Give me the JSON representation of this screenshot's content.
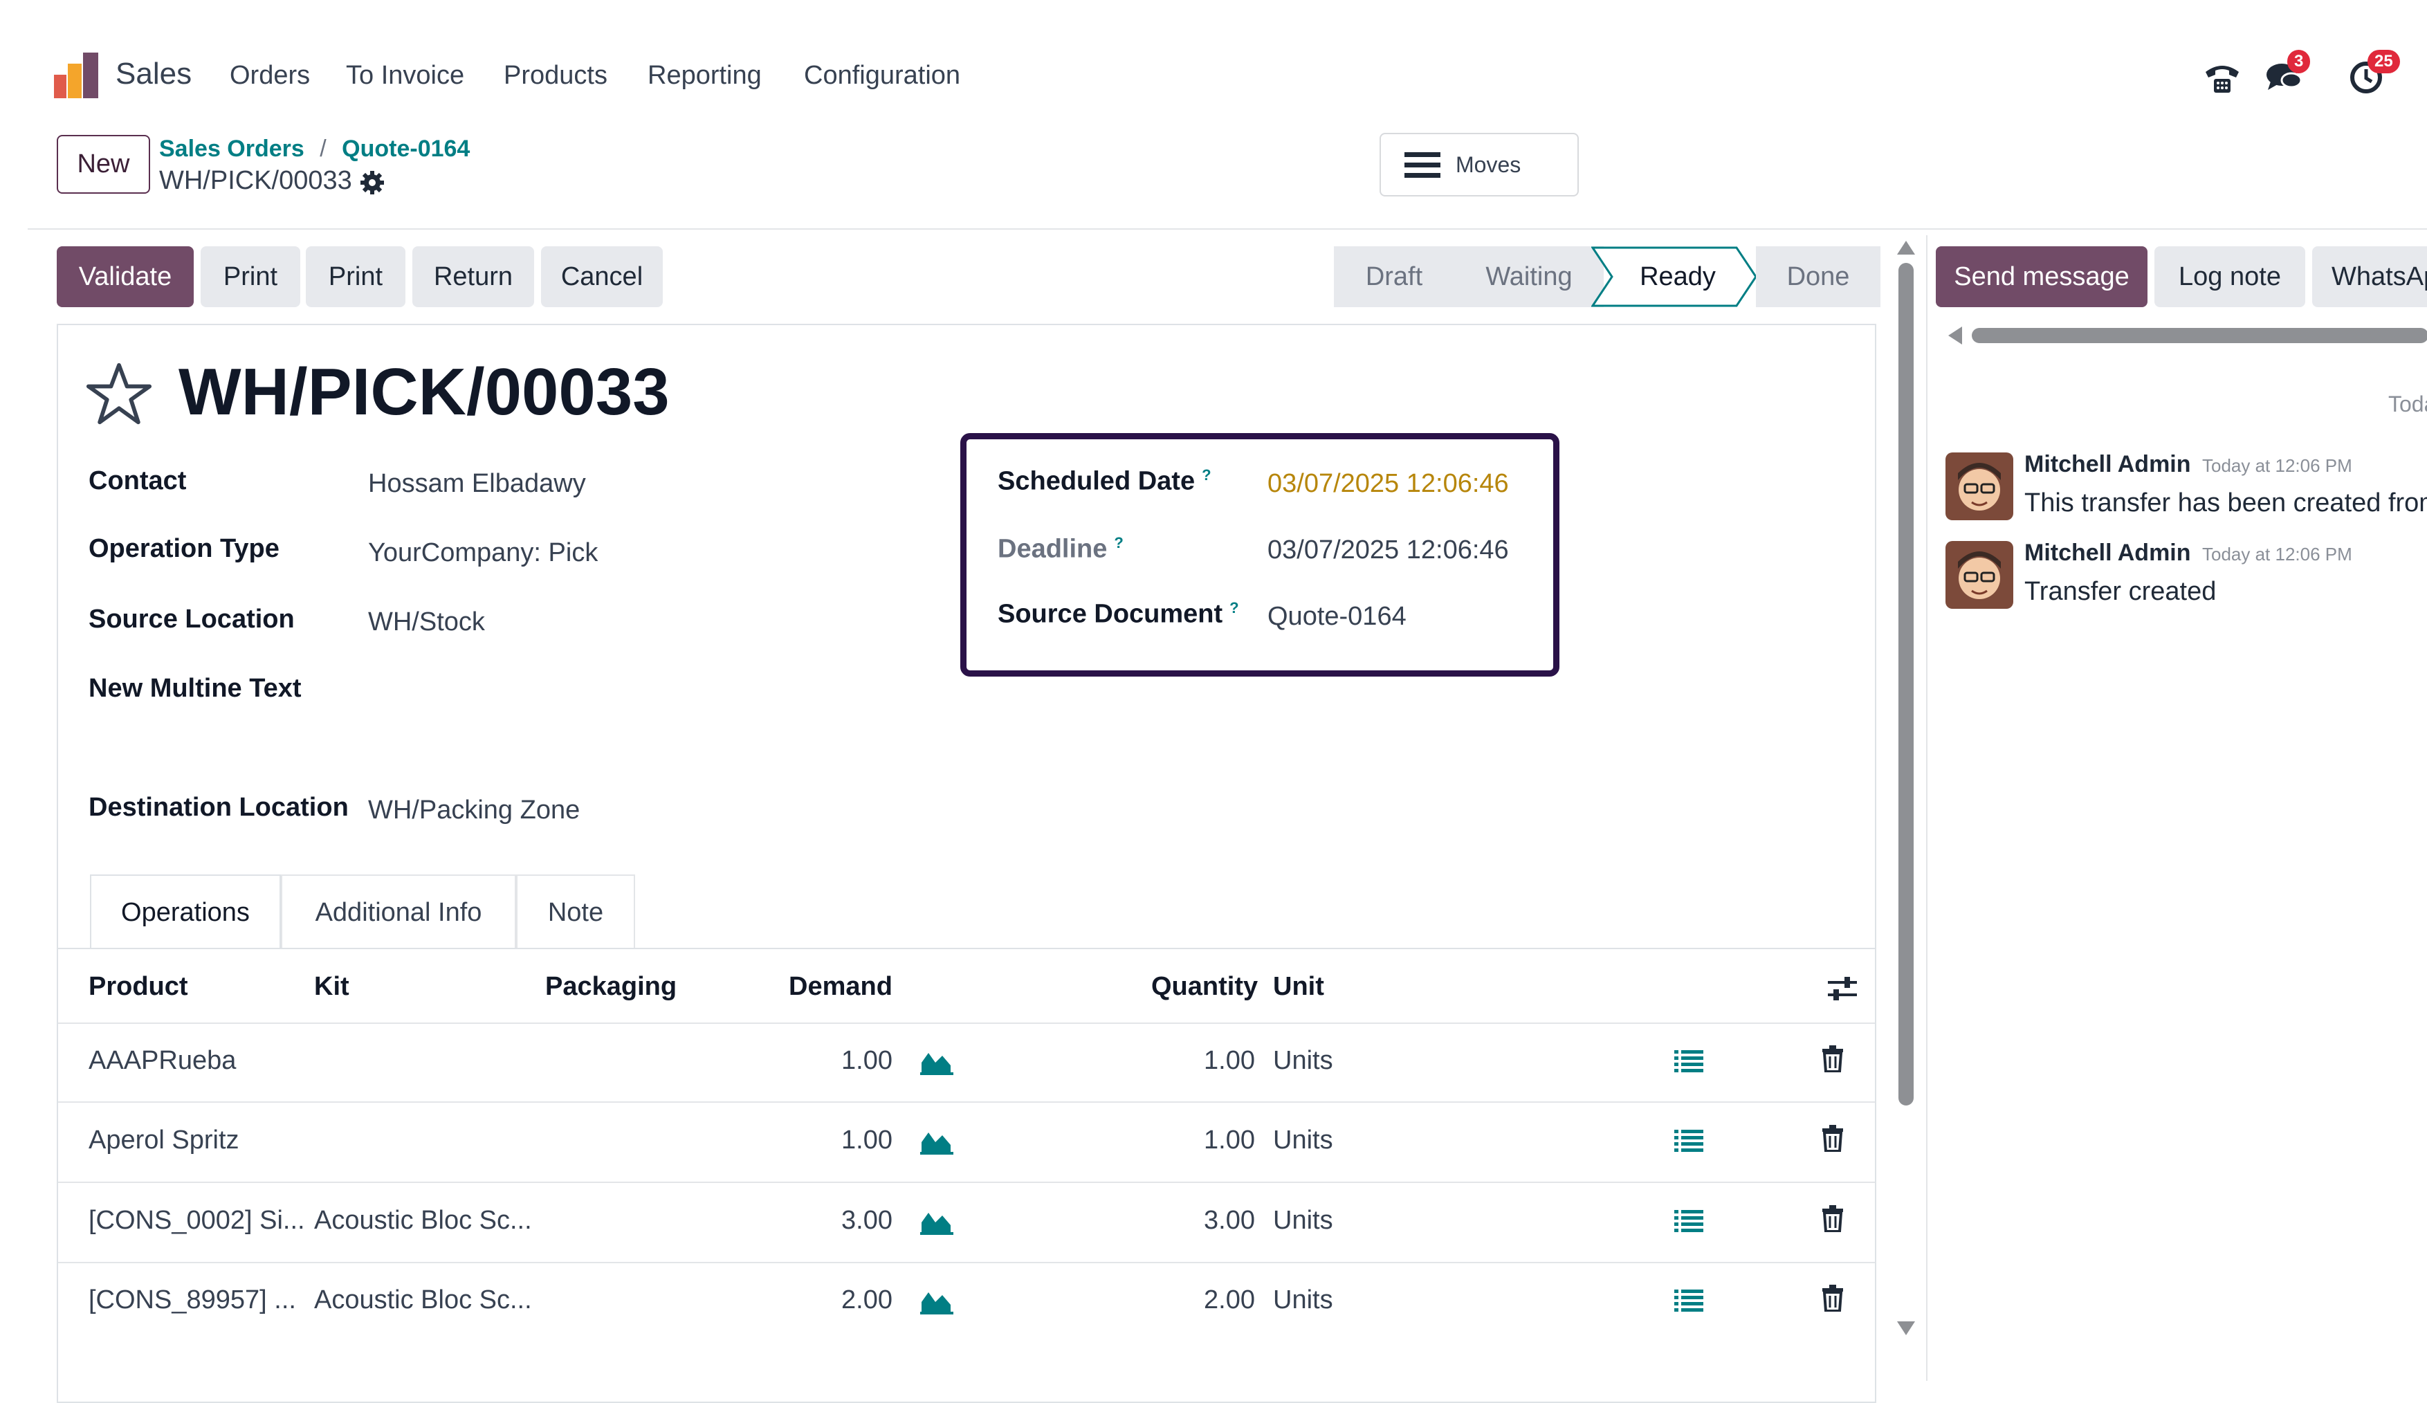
{
  "nav": {
    "app_name": "Sales",
    "menu": [
      "Orders",
      "To Invoice",
      "Products",
      "Reporting",
      "Configuration"
    ],
    "badges": {
      "messages": "3",
      "activities": "25"
    }
  },
  "control": {
    "new_label": "New",
    "breadcrumb": [
      "Sales Orders",
      "/",
      "Quote-0164"
    ],
    "record_name": "WH/PICK/00033",
    "moves_label": "Moves"
  },
  "actions": [
    "Validate",
    "Print",
    "Print",
    "Return",
    "Cancel"
  ],
  "stages": {
    "items": [
      "Draft",
      "Waiting",
      "Ready",
      "Done"
    ],
    "current": "Ready"
  },
  "form": {
    "title": "WH/PICK/00033",
    "left": [
      {
        "label": "Contact",
        "value": "Hossam Elbadawy"
      },
      {
        "label": "Operation Type",
        "value": "YourCompany: Pick"
      },
      {
        "label": "Source Location",
        "value": "WH/Stock"
      },
      {
        "label": "New Multine Text",
        "value": ""
      },
      {
        "label": "Destination Location",
        "value": "WH/Packing Zone"
      }
    ],
    "right": [
      {
        "label": "Scheduled Date",
        "value": "03/07/2025 12:06:46"
      },
      {
        "label": "Deadline",
        "value": "03/07/2025 12:06:46"
      },
      {
        "label": "Source Document",
        "value": "Quote-0164"
      }
    ],
    "help_mark": "?"
  },
  "tabs": [
    "Operations",
    "Additional Info",
    "Note"
  ],
  "table": {
    "headers": [
      "Product",
      "Kit",
      "Packaging",
      "Demand",
      "Quantity",
      "Unit"
    ],
    "rows": [
      {
        "product": "AAAPRueba",
        "kit": "",
        "demand": "1.00",
        "quantity": "1.00",
        "unit": "Units"
      },
      {
        "product": "Aperol Spritz",
        "kit": "",
        "demand": "1.00",
        "quantity": "1.00",
        "unit": "Units"
      },
      {
        "product": "[CONS_0002] Si...",
        "kit": "Acoustic Bloc Sc...",
        "demand": "3.00",
        "quantity": "3.00",
        "unit": "Units"
      },
      {
        "product": "[CONS_89957] ...",
        "kit": "Acoustic Bloc Sc...",
        "demand": "2.00",
        "quantity": "2.00",
        "unit": "Units"
      }
    ]
  },
  "chatter": {
    "send_message": "Send message",
    "log_note": "Log note",
    "whatsapp": "WhatsAp",
    "date_separator": "Toda",
    "messages": [
      {
        "author": "Mitchell Admin",
        "time": "Today at 12:06 PM",
        "body": "This transfer has been created from:"
      },
      {
        "author": "Mitchell Admin",
        "time": "Today at 12:06 PM",
        "body": "Transfer created"
      }
    ]
  },
  "colors": {
    "primary": "#714b67",
    "link": "#017e84",
    "scheduled_date": "#b7860b",
    "highlight_border": "#2a1248",
    "badge": "#e0293b"
  },
  "icons": [
    "odoo-logo-icon",
    "phone-icon",
    "chat-icon",
    "clock-icon",
    "gear-icon",
    "hamburger-icon",
    "star-icon",
    "forecast-chart-icon",
    "details-list-icon",
    "trash-icon",
    "column-settings-icon"
  ]
}
